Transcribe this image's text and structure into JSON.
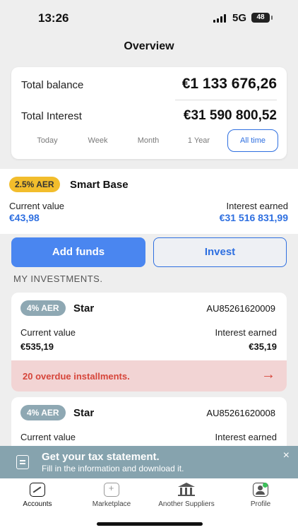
{
  "status_bar": {
    "time": "13:26",
    "network": "5G",
    "battery": "48"
  },
  "header": {
    "title": "Overview"
  },
  "balance_card": {
    "total_balance_label": "Total balance",
    "total_balance_value": "€1 133 676,26",
    "total_interest_label": "Total Interest",
    "total_interest_value": "€31 590 800,52",
    "periods": [
      "Today",
      "Week",
      "Month",
      "1 Year",
      "All time"
    ],
    "active_period": "All time"
  },
  "smart_base": {
    "badge": "2.5% AER",
    "name": "Smart Base",
    "current_value_label": "Current value",
    "current_value": "€43,98",
    "interest_earned_label": "Interest earned",
    "interest_earned": "€31 516 831,99"
  },
  "actions": {
    "add_funds": "Add funds",
    "invest": "Invest"
  },
  "investments": {
    "section_title": "MY INVESTMENTS.",
    "items": [
      {
        "badge": "4% AER",
        "name": "Star",
        "id": "AU85261620009",
        "current_value_label": "Current value",
        "current_value": "€535,19",
        "interest_earned_label": "Interest earned",
        "interest_earned": "€35,19",
        "alert": "20 overdue installments.",
        "alert_arrow": "→"
      },
      {
        "badge": "4% AER",
        "name": "Star",
        "id": "AU85261620008",
        "current_value_label": "Current value",
        "interest_earned_label": "Interest earned"
      }
    ]
  },
  "tax_banner": {
    "title": "Get your tax statement.",
    "subtitle": "Fill in the information and download it.",
    "close": "×"
  },
  "tab_bar": {
    "tabs": [
      {
        "label": "Accounts",
        "icon": "chart-icon",
        "active": true
      },
      {
        "label": "Marketplace",
        "icon": "plus-icon",
        "active": false
      },
      {
        "label": "Another Suppliers",
        "icon": "bank-icon",
        "active": false
      },
      {
        "label": "Profile",
        "icon": "profile-icon",
        "active": false
      }
    ]
  },
  "colors": {
    "accent": "#2e6fe0",
    "button": "#4a86f0",
    "badge_yellow": "#f2bd2c",
    "badge_grey": "#8ea8b3",
    "alert_bg": "#f2d4d4",
    "alert_text": "#d6453a",
    "banner": "#86a3ae"
  }
}
